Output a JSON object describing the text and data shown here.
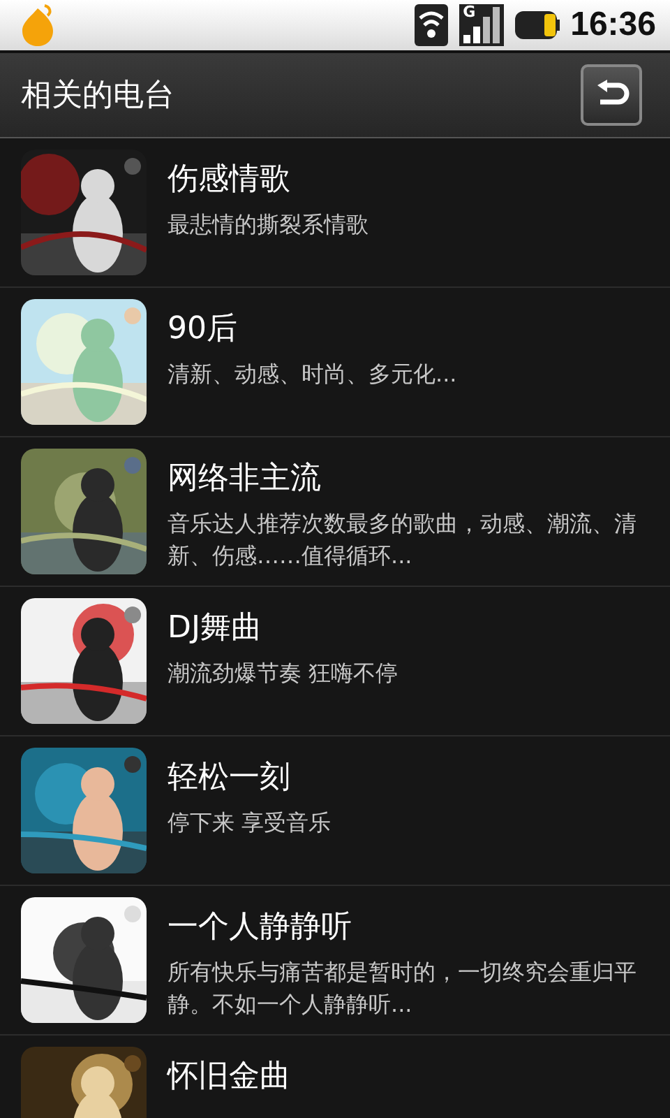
{
  "status_bar": {
    "time": "16:36",
    "network": "G"
  },
  "header": {
    "title": "相关的电台"
  },
  "stations": [
    {
      "kind": "picture",
      "title": "伤感情歌",
      "description": "最悲情的撕裂系情歌"
    },
    {
      "kind": "picture",
      "title": "90后",
      "description": "清新、动感、时尚、多元化..."
    },
    {
      "kind": "picture",
      "title": "网络非主流",
      "description": "音乐达人推荐次数最多的歌曲，动感、潮流、清新、伤感……值得循环..."
    },
    {
      "kind": "picture",
      "title": "DJ舞曲",
      "description": "潮流劲爆节奏 狂嗨不停"
    },
    {
      "kind": "picture",
      "title": "轻松一刻",
      "description": "停下来 享受音乐"
    },
    {
      "kind": "picture",
      "title": "一个人静静听",
      "description": "所有快乐与痛苦都是暂时的，一切终究会重归平静。不如一个人静静听..."
    },
    {
      "kind": "picture",
      "title": "怀旧金曲"
    }
  ]
}
